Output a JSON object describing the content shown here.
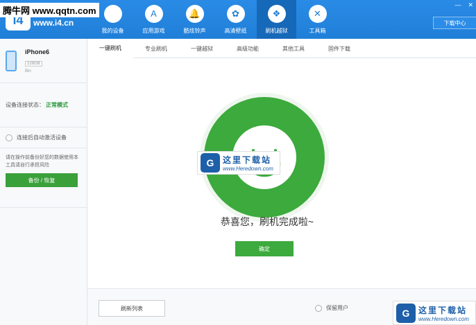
{
  "site_tag": "腾牛网 www.qqtn.com",
  "logo": {
    "glyph": "i4",
    "url": "www.i4.cn"
  },
  "nav": [
    {
      "label": "我的设备",
      "icon": ""
    },
    {
      "label": "应用游戏",
      "icon": "A"
    },
    {
      "label": "酷炫铃声",
      "icon": "🔔"
    },
    {
      "label": "高清壁纸",
      "icon": "✿"
    },
    {
      "label": "刷机越狱",
      "icon": "❖"
    },
    {
      "label": "工具箱",
      "icon": "✕"
    }
  ],
  "window": {
    "minimize": "—",
    "close": "✕",
    "download_center": "下载中心"
  },
  "device": {
    "name": "iPhone6",
    "capacity": "128GB",
    "color": "Bin"
  },
  "connection": {
    "label": "设备连接状态：",
    "value": "正常模式"
  },
  "auto_activate": {
    "label": "连接后自动激活设备"
  },
  "backup": {
    "note": "请在操作前备份好您的数据使用本工具请自行承担风险",
    "button": "备份 / 恢复"
  },
  "tabs": [
    "一键刷机",
    "专业刷机",
    "一键越狱",
    "高级功能",
    "其他工具",
    "固件下载"
  ],
  "result": {
    "message": "恭喜您，刷机完成啦~",
    "confirm": "确定"
  },
  "footer": {
    "refresh": "刷新列表",
    "keep_data": "保留用户"
  },
  "watermark": {
    "title": "这里下载站",
    "url": "www.Heredown.com"
  },
  "colors": {
    "header": "#1f7fd8",
    "success_green": "#3caa3c"
  }
}
